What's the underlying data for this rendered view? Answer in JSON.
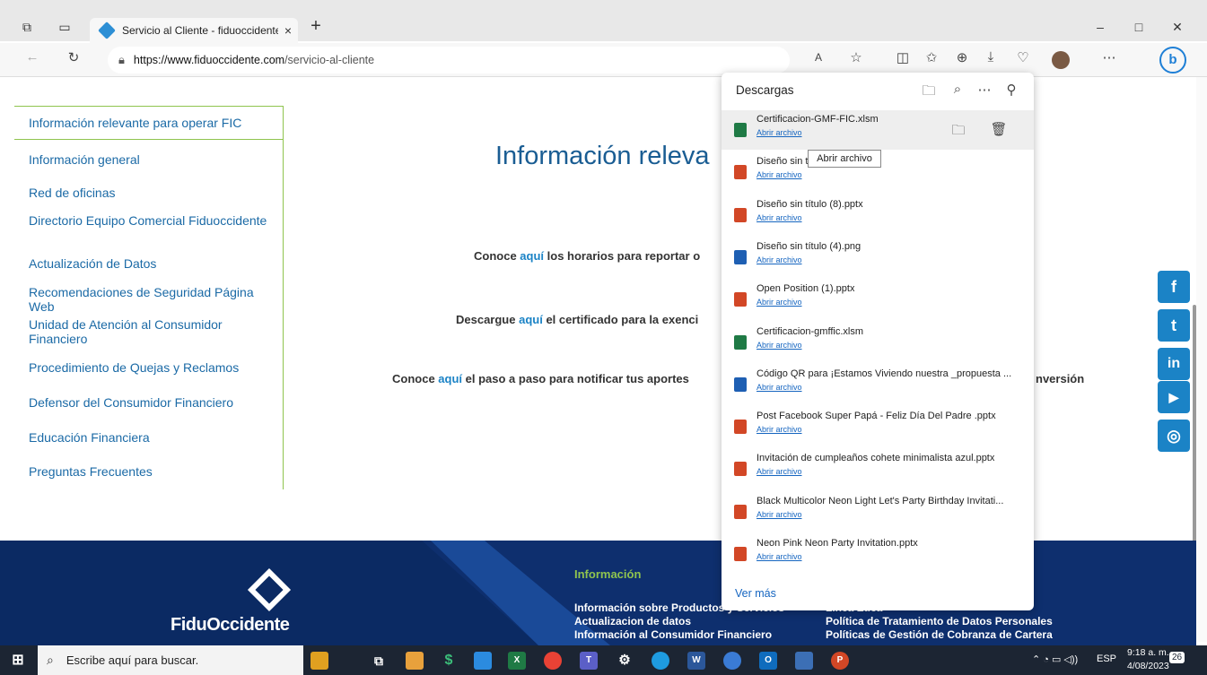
{
  "browser": {
    "tab_title": "Servicio al Cliente - fiduoccidente",
    "tab_close": "×",
    "new_tab": "+",
    "url_host": "https://www.fiduoccidente.com",
    "url_path": "/servicio-al-cliente",
    "win_min": "–",
    "win_max": "□",
    "win_close": "✕"
  },
  "left_menu": {
    "items": [
      "Información relevante para operar FIC",
      "Información general",
      "Red de oficinas",
      "Directorio Equipo Comercial Fiduoccidente",
      "Actualización de Datos",
      "Recomendaciones de Seguridad Página Web",
      "Unidad de Atención al Consumidor Financiero",
      "Procedimiento de Quejas y Reclamos",
      "Defensor del Consumidor Financiero",
      "Educación Financiera",
      "Preguntas Frecuentes"
    ]
  },
  "main": {
    "heading": "Información releva",
    "para1_pre": "Conoce ",
    "para1_link": "aquí",
    "para1_post": " los horarios para reportar o",
    "para2_pre": "Descargue ",
    "para2_link": "aquí",
    "para2_post": " el certificado para la exenci",
    "para3_pre": "Conoce ",
    "para3_link": "aquí",
    "para3_post": " el paso a paso para notificar tus aportes",
    "para3_tail": "nversión"
  },
  "social": [
    "f",
    "t",
    "in",
    "▶",
    "◎"
  ],
  "footer": {
    "logo_text": "FiduOccidente",
    "heading": "Información",
    "col1": [
      "Información sobre Productos y Servicios",
      "Actualizacion de datos",
      "Información al Consumidor Financiero"
    ],
    "col2": [
      "Línea Ética",
      "Política de Tratamiento de Datos Personales",
      "Políticas de Gestión de Cobranza de Cartera"
    ]
  },
  "downloads": {
    "title": "Descargas",
    "open_label": "Abrir archivo",
    "tooltip": "Abrir archivo",
    "see_more": "Ver más",
    "items": [
      {
        "name": "Certificacion-GMF-FIC.xlsm",
        "type": "xl"
      },
      {
        "name": "Diseño sin t",
        "type": "pp"
      },
      {
        "name": "Diseño sin título (8).pptx",
        "type": "pp"
      },
      {
        "name": "Diseño sin título (4).png",
        "type": "img"
      },
      {
        "name": "Open Position (1).pptx",
        "type": "pp"
      },
      {
        "name": "Certificacion-gmffic.xlsm",
        "type": "xl"
      },
      {
        "name": "Código QR para ¡Estamos Viviendo nuestra _propuesta ...",
        "type": "img"
      },
      {
        "name": "Post Facebook Super Papá - Feliz Día Del Padre .pptx",
        "type": "pp"
      },
      {
        "name": "Invitación de cumpleaños cohete minimalista azul.pptx",
        "type": "pp"
      },
      {
        "name": "Black Multicolor Neon Light Let's Party Birthday Invitati...",
        "type": "pp"
      },
      {
        "name": "Neon Pink Neon Party Invitation.pptx",
        "type": "pp"
      }
    ]
  },
  "taskbar": {
    "search_placeholder": "Escribe aquí para buscar.",
    "lang": "ESP",
    "time": "9:18 a. m.",
    "date": "4/08/2023",
    "notif": "26"
  },
  "colors": {
    "link_blue": "#1b83c6",
    "menu_border": "#8fc44e",
    "footer_bg": "#0e2f6e"
  }
}
